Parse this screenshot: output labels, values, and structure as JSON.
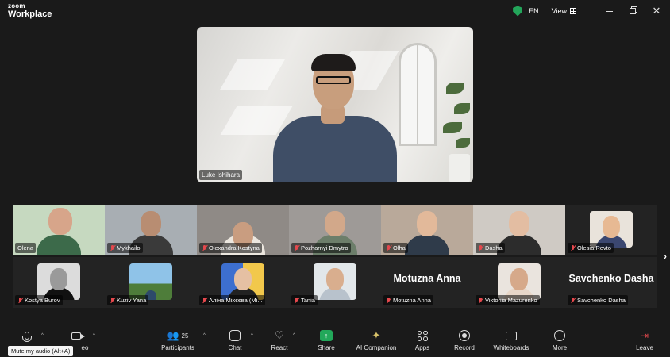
{
  "app": {
    "brand_small": "zoom",
    "brand_large": "Workplace"
  },
  "titlebar": {
    "language": "EN",
    "view_label": "View"
  },
  "speaker": {
    "name": "Luke Ishihara"
  },
  "gallery": {
    "row1": [
      {
        "name": "Olena",
        "muted": false
      },
      {
        "name": "Mykhailo",
        "muted": true
      },
      {
        "name": "Olexandra Kostyna",
        "muted": true
      },
      {
        "name": "Pozharnyi Dmytro",
        "muted": true
      },
      {
        "name": "Olha",
        "muted": true
      },
      {
        "name": "Dasha",
        "muted": true
      },
      {
        "name": "Olesia Revto",
        "muted": true
      }
    ],
    "row2": [
      {
        "name": "Kostya Burov",
        "muted": true
      },
      {
        "name": "Kuziv Yana",
        "muted": true
      },
      {
        "name": "Аліна Міхєєва (Mi...",
        "muted": true
      },
      {
        "name": "Tania",
        "muted": true
      },
      {
        "name": "Motuzna Anna",
        "muted": true,
        "big_name": "Motuzna Anna"
      },
      {
        "name": "Viktoriia Mazurenko",
        "muted": true
      },
      {
        "name": "Savchenko Dasha",
        "muted": true,
        "big_name": "Savchenko Dasha"
      }
    ]
  },
  "toolbar": {
    "video_label": "eo",
    "participants_label": "Participants",
    "participants_count": "25",
    "chat_label": "Chat",
    "react_label": "React",
    "share_label": "Share",
    "ai_label": "AI Companion",
    "apps_label": "Apps",
    "record_label": "Record",
    "whiteboards_label": "Whiteboards",
    "more_label": "More",
    "leave_label": "Leave"
  },
  "tooltip": "Mute my audio (Alt+A)",
  "colors": {
    "background": "#1a1a1a",
    "share_green": "#22a85a",
    "muted_red": "#e5484d",
    "leave_red": "#e5484d"
  }
}
